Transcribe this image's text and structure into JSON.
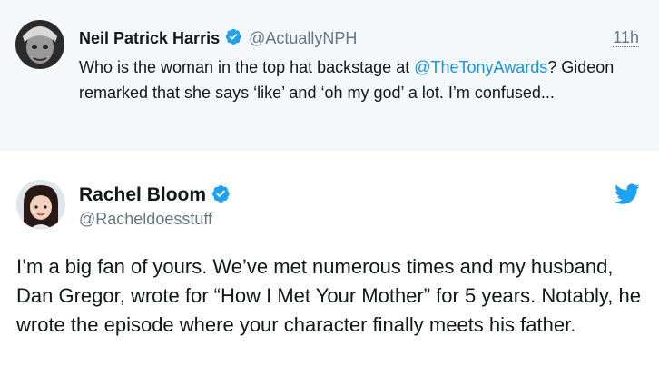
{
  "quoted_tweet": {
    "avatar_icon": "neil-patrick-harris-avatar",
    "name": "Neil Patrick Harris",
    "handle": "@ActuallyNPH",
    "time": "11h",
    "text_before": "Who is the woman in the top hat backstage at ",
    "mention": "@TheTonyAwards",
    "text_after": "? Gideon remarked that she says ‘like’ and ‘oh my god’ a lot. I’m confused..."
  },
  "main_tweet": {
    "avatar_icon": "rachel-bloom-avatar",
    "name": "Rachel Bloom",
    "handle": "@Racheldoesstuff",
    "text": "I’m a big fan of yours. We’ve met numerous times and my husband, Dan Gregor, wrote for “How I Met Your Mother” for 5 years. Notably, he wrote the episode where your character finally meets his father."
  },
  "icons": {
    "verified": "verified-badge-icon",
    "twitter": "twitter-bird-icon"
  },
  "colors": {
    "verified_blue": "#1da1f2",
    "link_blue": "#1b95e0",
    "secondary_text": "#657786",
    "quoted_background": "#f5f8fa"
  }
}
